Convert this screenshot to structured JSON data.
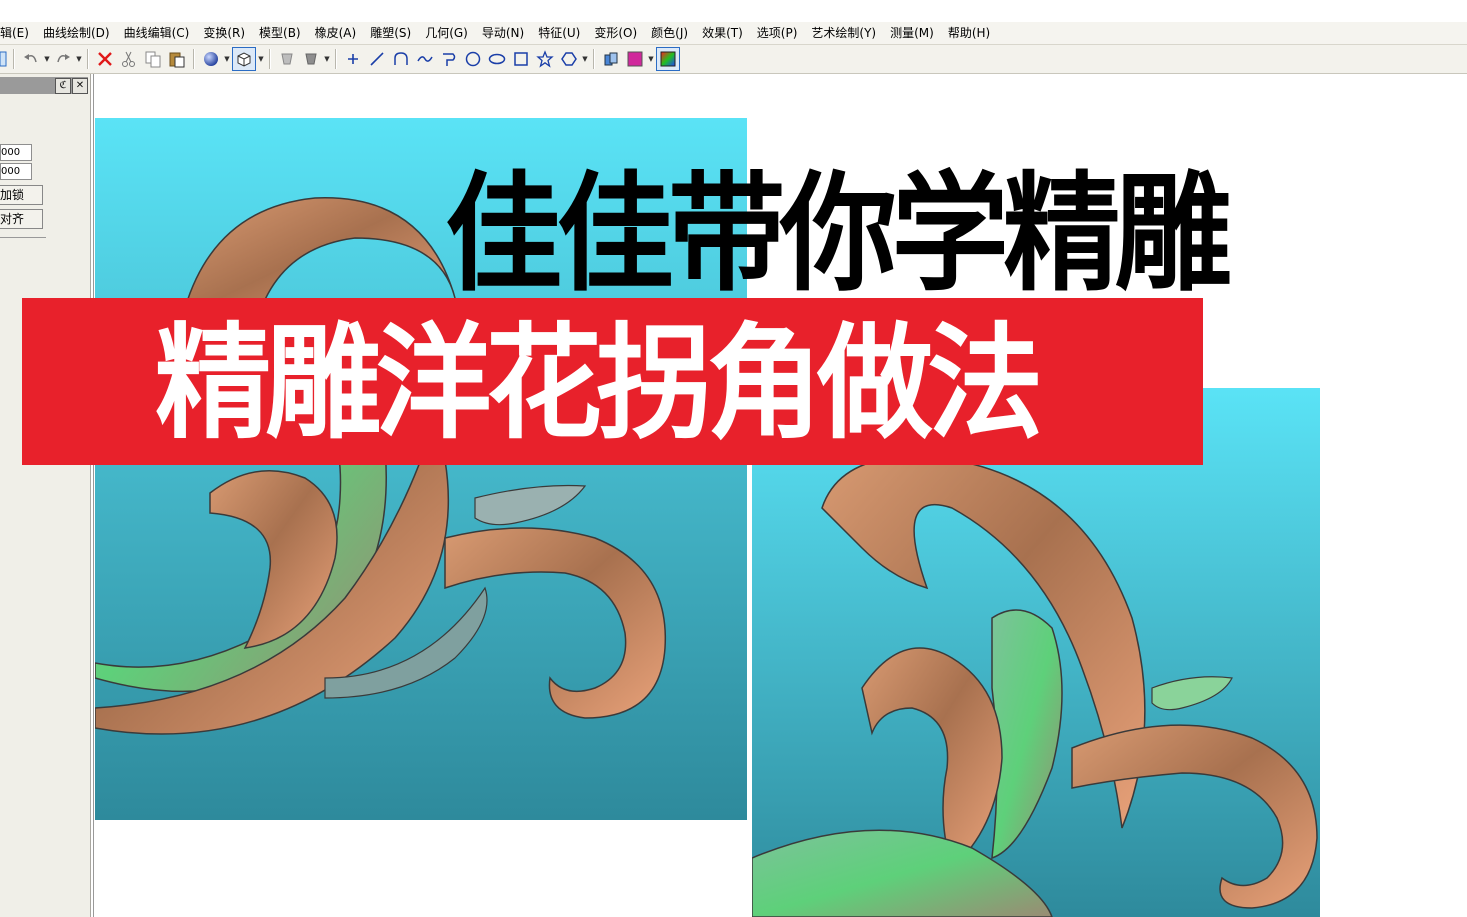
{
  "menu": {
    "items": [
      "辑(E)",
      "曲线绘制(D)",
      "曲线编辑(C)",
      "变换(R)",
      "模型(B)",
      "橡皮(A)",
      "雕塑(S)",
      "几何(G)",
      "导动(N)",
      "特征(U)",
      "变形(O)",
      "颜色(J)",
      "效果(T)",
      "选项(P)",
      "艺术绘制(Y)",
      "测量(M)",
      "帮助(H)"
    ]
  },
  "left_panel": {
    "field_1": "000",
    "field_2": "000",
    "button_lock": "加锁",
    "button_align": "对齐",
    "pin_glyph": "ℭ",
    "close_glyph": "✕"
  },
  "overlay": {
    "headline": "佳佳带你学精雕",
    "banner": "精雕洋花拐角做法"
  },
  "colors": {
    "banner_red": "#e8212b",
    "relief_bg_top": "#5ae3f6",
    "relief_bg_bottom": "#2e8a9c",
    "relief_copper": "#c17a52",
    "relief_green": "#58c870"
  },
  "toolbar": {
    "icons": [
      "select-icon",
      "undo-icon",
      "redo-icon",
      "delete-icon",
      "cut-icon",
      "copy-icon",
      "paste-icon",
      "sphere-view-icon",
      "cube-view-icon",
      "shade-icon",
      "render-icon",
      "point-icon",
      "line-icon",
      "arc-icon",
      "curve-icon",
      "polyline-icon",
      "circle-icon",
      "ellipse-icon",
      "rectangle-icon",
      "star-icon",
      "polygon-icon",
      "color-tool-icon",
      "color-swatch-icon",
      "palette-icon"
    ]
  }
}
